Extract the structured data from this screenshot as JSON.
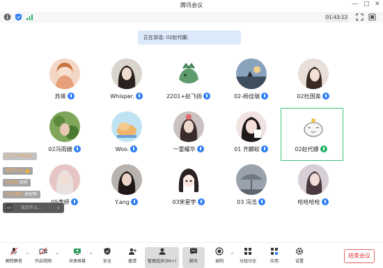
{
  "window": {
    "title": "腾讯会议"
  },
  "toolbar": {
    "timer": "01:43:12"
  },
  "speaking": "正在讲话: 02赵代娜;",
  "participants": [
    {
      "name": "苏瑛",
      "mic": "blue"
    },
    {
      "name": "Whisper.",
      "mic": "blue"
    },
    {
      "name": "2201+赵飞扬",
      "mic": "blue"
    },
    {
      "name": "02-杨佳瑞",
      "mic": "blue"
    },
    {
      "name": "02杜国英",
      "mic": "blue"
    },
    {
      "name": "02冯雨姗",
      "mic": "blue"
    },
    {
      "name": "Woo.",
      "mic": "blue"
    },
    {
      "name": "一雷耀华",
      "mic": "blue"
    },
    {
      "name": "01 齐麟蛟",
      "mic": "blue"
    },
    {
      "name": "02赵代娜",
      "mic": "green"
    },
    {
      "name": "05李妍",
      "mic": "blue"
    },
    {
      "name": "Y.ang",
      "mic": "blue"
    },
    {
      "name": "03宋星宇",
      "mic": "blue"
    },
    {
      "name": "03 冯浩",
      "mic": "blue"
    },
    {
      "name": "哈哈哈哈",
      "mic": "blue"
    }
  ],
  "chat": [
    {
      "name": "157****8900:",
      "text": ""
    },
    {
      "name": "燃梦18岁:",
      "text": "👍"
    },
    {
      "name": "吕佳敏:",
      "text": "好听"
    },
    {
      "name": "01赵雅廷:",
      "text": "好好听"
    }
  ],
  "chat_input": {
    "placeholder": "说点什么...",
    "collapse": "‹"
  },
  "bottom": [
    {
      "id": "mute",
      "label": "解除静音",
      "icon": "mic-muted-icon"
    },
    {
      "id": "video",
      "label": "开启视频",
      "icon": "video-off-icon"
    },
    {
      "id": "share",
      "label": "共享屏幕",
      "icon": "screen-share-icon"
    },
    {
      "id": "security",
      "label": "安全",
      "icon": "shield-icon"
    },
    {
      "id": "invite",
      "label": "邀请",
      "icon": "invite-icon"
    },
    {
      "id": "members",
      "label": "管理成员(99+)",
      "icon": "members-icon"
    },
    {
      "id": "chat",
      "label": "聊天",
      "icon": "chat-icon"
    },
    {
      "id": "record",
      "label": "录制",
      "icon": "record-icon"
    },
    {
      "id": "breakout",
      "label": "分组讨论",
      "icon": "breakout-icon"
    },
    {
      "id": "apps",
      "label": "应用",
      "icon": "apps-icon"
    },
    {
      "id": "settings",
      "label": "设置",
      "icon": "settings-icon"
    }
  ],
  "end_button": "结束会议",
  "colors": {
    "accent": "#2f7ef5",
    "active_border": "#39c47a",
    "end": "#e03c3c"
  }
}
